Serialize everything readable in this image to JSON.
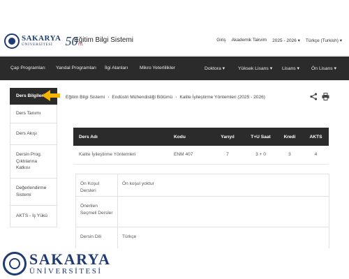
{
  "header": {
    "logo_main": "SAKARYA",
    "logo_sub": "ÜNİVERSİTESİ",
    "anniversary": "50",
    "anniversary_sub": "YIL",
    "app_title": "Eğitim Bilgi Sistemi",
    "links": [
      "Giriş",
      "Akademik Takvim",
      "2025 - 2026 ▾",
      "Türkçe (Turkish) ▾"
    ]
  },
  "navbar": {
    "items": [
      "Çap Programları",
      "Yandal Programları",
      "İlgi Alanları",
      "Mikro Yeterlilikler",
      "Doktora ▾",
      "Yüksek Lisans ▾",
      "Lisans ▾",
      "Ön Lisans ▾"
    ]
  },
  "sidebar": {
    "items": [
      "Ders Bilgileri",
      "Ders Tanımı",
      "Ders Akışı",
      "Dersin Prog. Çıktılarına Katkısı",
      "Değerlendirme Sistemi",
      "AKTS - İş Yükü"
    ]
  },
  "breadcrumb": [
    "Eğitim Bilgi Sistemi",
    "Endüstri Mühendisliği Bölümü",
    "Kalite İyileştirme Yöntemleri (2025 - 2026)"
  ],
  "table": {
    "headers": [
      "Ders Adı",
      "Kodu",
      "Yarıyıl",
      "T+U Saat",
      "Kredi",
      "AKTS"
    ],
    "row": [
      "Kalite İyileştirme Yöntemleri",
      "ENM 407",
      "7",
      "3 + 0",
      "3",
      "4"
    ]
  },
  "info": [
    {
      "key": "Ön Koşul Dersleri",
      "value": "Ön koşul yoktur"
    },
    {
      "key": "Önerilen Seçmeli Dersler",
      "value": ""
    },
    {
      "key": "Dersin Dili",
      "value": "Türkçe"
    }
  ],
  "footer_logo": {
    "main": "SAKARYA",
    "sub": "ÜNİVERSİTESİ"
  },
  "colors": {
    "brand": "#1f3b73",
    "navbar": "#2b2b2b",
    "arrow": "#f4b400"
  }
}
